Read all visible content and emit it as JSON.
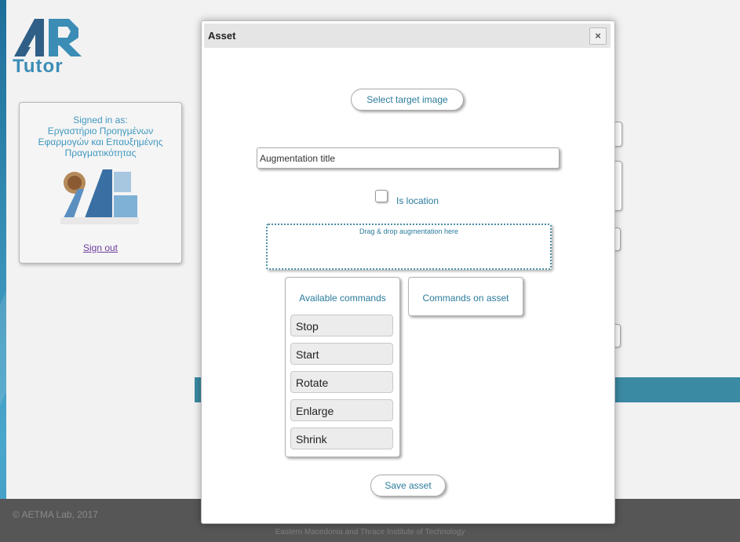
{
  "logo": {
    "mark": "AR",
    "subtitle": "Tutor"
  },
  "signed_in": {
    "heading": "Signed in as:",
    "org_line1": "Εργαστήριο Προηγμένων",
    "org_line2": "Εφαρμογών και Επαυξημένης",
    "org_line3": "Πραγματικότητας",
    "sign_out": "Sign out"
  },
  "modal": {
    "title": "Asset",
    "close_label": "×",
    "select_target_label": "Select target image",
    "title_placeholder": "Augmentation title",
    "is_location_label": "Is location",
    "is_location_checked": false,
    "dropzone_text": "Drag & drop augmentation here",
    "available_commands_title": "Available commands",
    "commands_on_asset_title": "Commands on asset",
    "commands": [
      "Stop",
      "Start",
      "Rotate",
      "Enlarge",
      "Shrink"
    ],
    "save_label": "Save asset"
  },
  "footer": {
    "copyright": "© AETMA Lab, 2017",
    "institute": "Eastern Macedonia and Thrace Institute of Technology"
  },
  "colors": {
    "accent": "#2b7c9c",
    "brand": "#3b8db6",
    "bar": "#3b8aa3",
    "footer": "#565656"
  }
}
